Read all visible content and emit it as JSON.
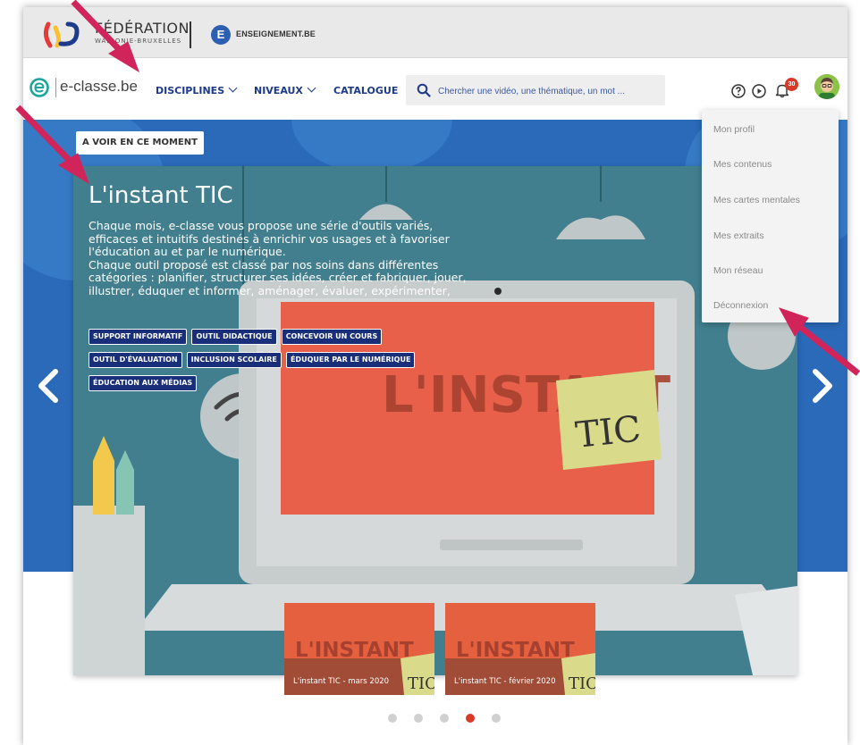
{
  "header": {
    "federation_title": "FÉDÉRATION",
    "federation_sub": "WALLONIE-BRUXELLES",
    "enseignement_letter": "E",
    "enseignement_label": "ENSEIGNEMENT.BE"
  },
  "nav": {
    "brand": "e-classe.be",
    "disciplines": "DISCIPLINES",
    "niveaux": "NIVEAUX",
    "catalogue": "CATALOGUE",
    "search_placeholder": "Chercher une vidéo, une thématique, un mot ...",
    "notification_count": "30"
  },
  "hero": {
    "badge": "A VOIR EN CE MOMENT",
    "title": "L'instant TIC",
    "description_lines": [
      "Chaque mois, e-classe vous propose une série d'outils variés,",
      "efficaces et intuitifs destinés à enrichir vos usages et à favoriser",
      "l'éducation au et par le numérique.",
      "Chaque outil proposé est classé par nos soins dans différentes",
      "catégories : planifier, structurer ses idées, créer et fabriquer, jouer,",
      "illustrer, éduquer et informer, aménager, évaluer, expérimenter,"
    ],
    "tags": [
      "SUPPORT INFORMATIF",
      "OUTIL DIDACTIQUE",
      "CONCEVOIR UN COURS",
      "OUTIL D'ÉVALUATION",
      "INCLUSION SCOLAIRE",
      "ÉDUQUER PAR LE NUMÉRIQUE",
      "ÉDUCATION AUX MÉDIAS"
    ],
    "artwork_heading": "L'INSTANT",
    "artwork_note": "TIC"
  },
  "thumbnails": [
    {
      "heading": "L'INSTANT",
      "note": "TIC",
      "caption": "L'instant TIC - mars 2020"
    },
    {
      "heading": "L'INSTANT",
      "note": "TIC",
      "caption": "L'instant TIC - février 2020"
    }
  ],
  "carousel": {
    "dot_count": 5,
    "active_dot": 4
  },
  "user_menu": {
    "items": [
      "Mon profil",
      "Mes contenus",
      "Mes cartes mentales",
      "Mes extraits",
      "Mon réseau",
      "Déconnexion"
    ]
  },
  "colors": {
    "brand_navy": "#1d3a8a",
    "tag_bg": "#1a2f7a",
    "hero_blue": "#2a6ab8",
    "accent_red": "#d83a2a",
    "annotation_arrow": "#d0245a"
  }
}
